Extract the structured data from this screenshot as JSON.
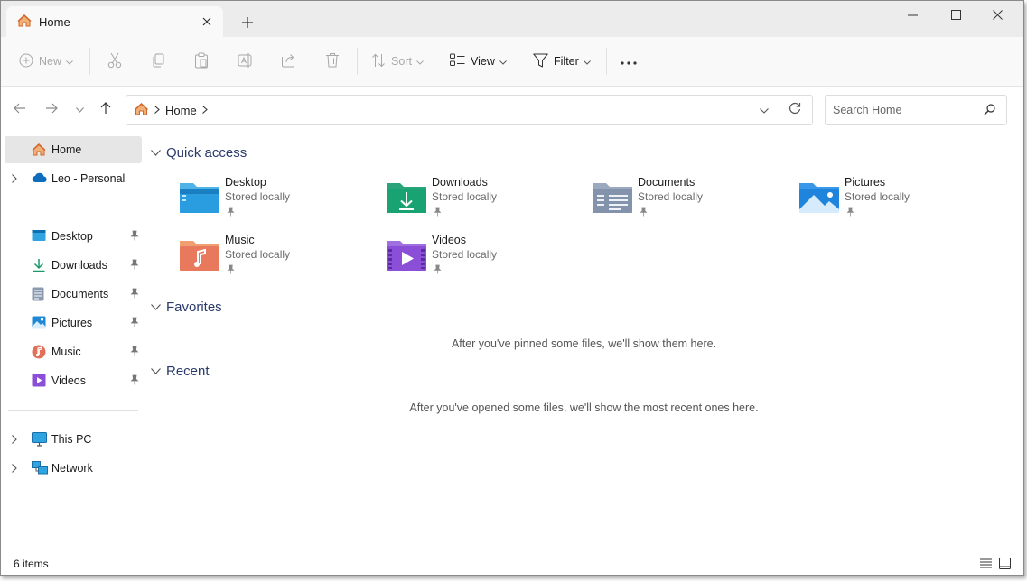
{
  "tab": {
    "title": "Home"
  },
  "toolbar": {
    "new_label": "New",
    "sort_label": "Sort",
    "view_label": "View",
    "filter_label": "Filter"
  },
  "address": {
    "crumb": "Home",
    "search_placeholder": "Search Home"
  },
  "sidebar": {
    "home": "Home",
    "onedrive": "Leo - Personal",
    "pinned": [
      {
        "label": "Desktop",
        "icon": "desktop-icon"
      },
      {
        "label": "Downloads",
        "icon": "downloads-icon"
      },
      {
        "label": "Documents",
        "icon": "documents-icon"
      },
      {
        "label": "Pictures",
        "icon": "pictures-icon"
      },
      {
        "label": "Music",
        "icon": "music-icon"
      },
      {
        "label": "Videos",
        "icon": "videos-icon"
      }
    ],
    "this_pc": "This PC",
    "network": "Network"
  },
  "main": {
    "quick_access_title": "Quick access",
    "favorites_title": "Favorites",
    "recent_title": "Recent",
    "favorites_empty": "After you've pinned some files, we'll show them here.",
    "recent_empty": "After you've opened some files, we'll show the most recent ones here.",
    "folders": [
      {
        "name": "Desktop",
        "sub": "Stored locally",
        "icon": "desktop-folder-icon"
      },
      {
        "name": "Downloads",
        "sub": "Stored locally",
        "icon": "downloads-folder-icon"
      },
      {
        "name": "Documents",
        "sub": "Stored locally",
        "icon": "documents-folder-icon"
      },
      {
        "name": "Pictures",
        "sub": "Stored locally",
        "icon": "pictures-folder-icon"
      },
      {
        "name": "Music",
        "sub": "Stored locally",
        "icon": "music-folder-icon"
      },
      {
        "name": "Videos",
        "sub": "Stored locally",
        "icon": "videos-folder-icon"
      }
    ]
  },
  "status": {
    "items": "6 items"
  },
  "colors": {
    "accent": "#0067c0",
    "section_heading": "#2a3a6a",
    "selected_bg": "#e6e6e6"
  }
}
